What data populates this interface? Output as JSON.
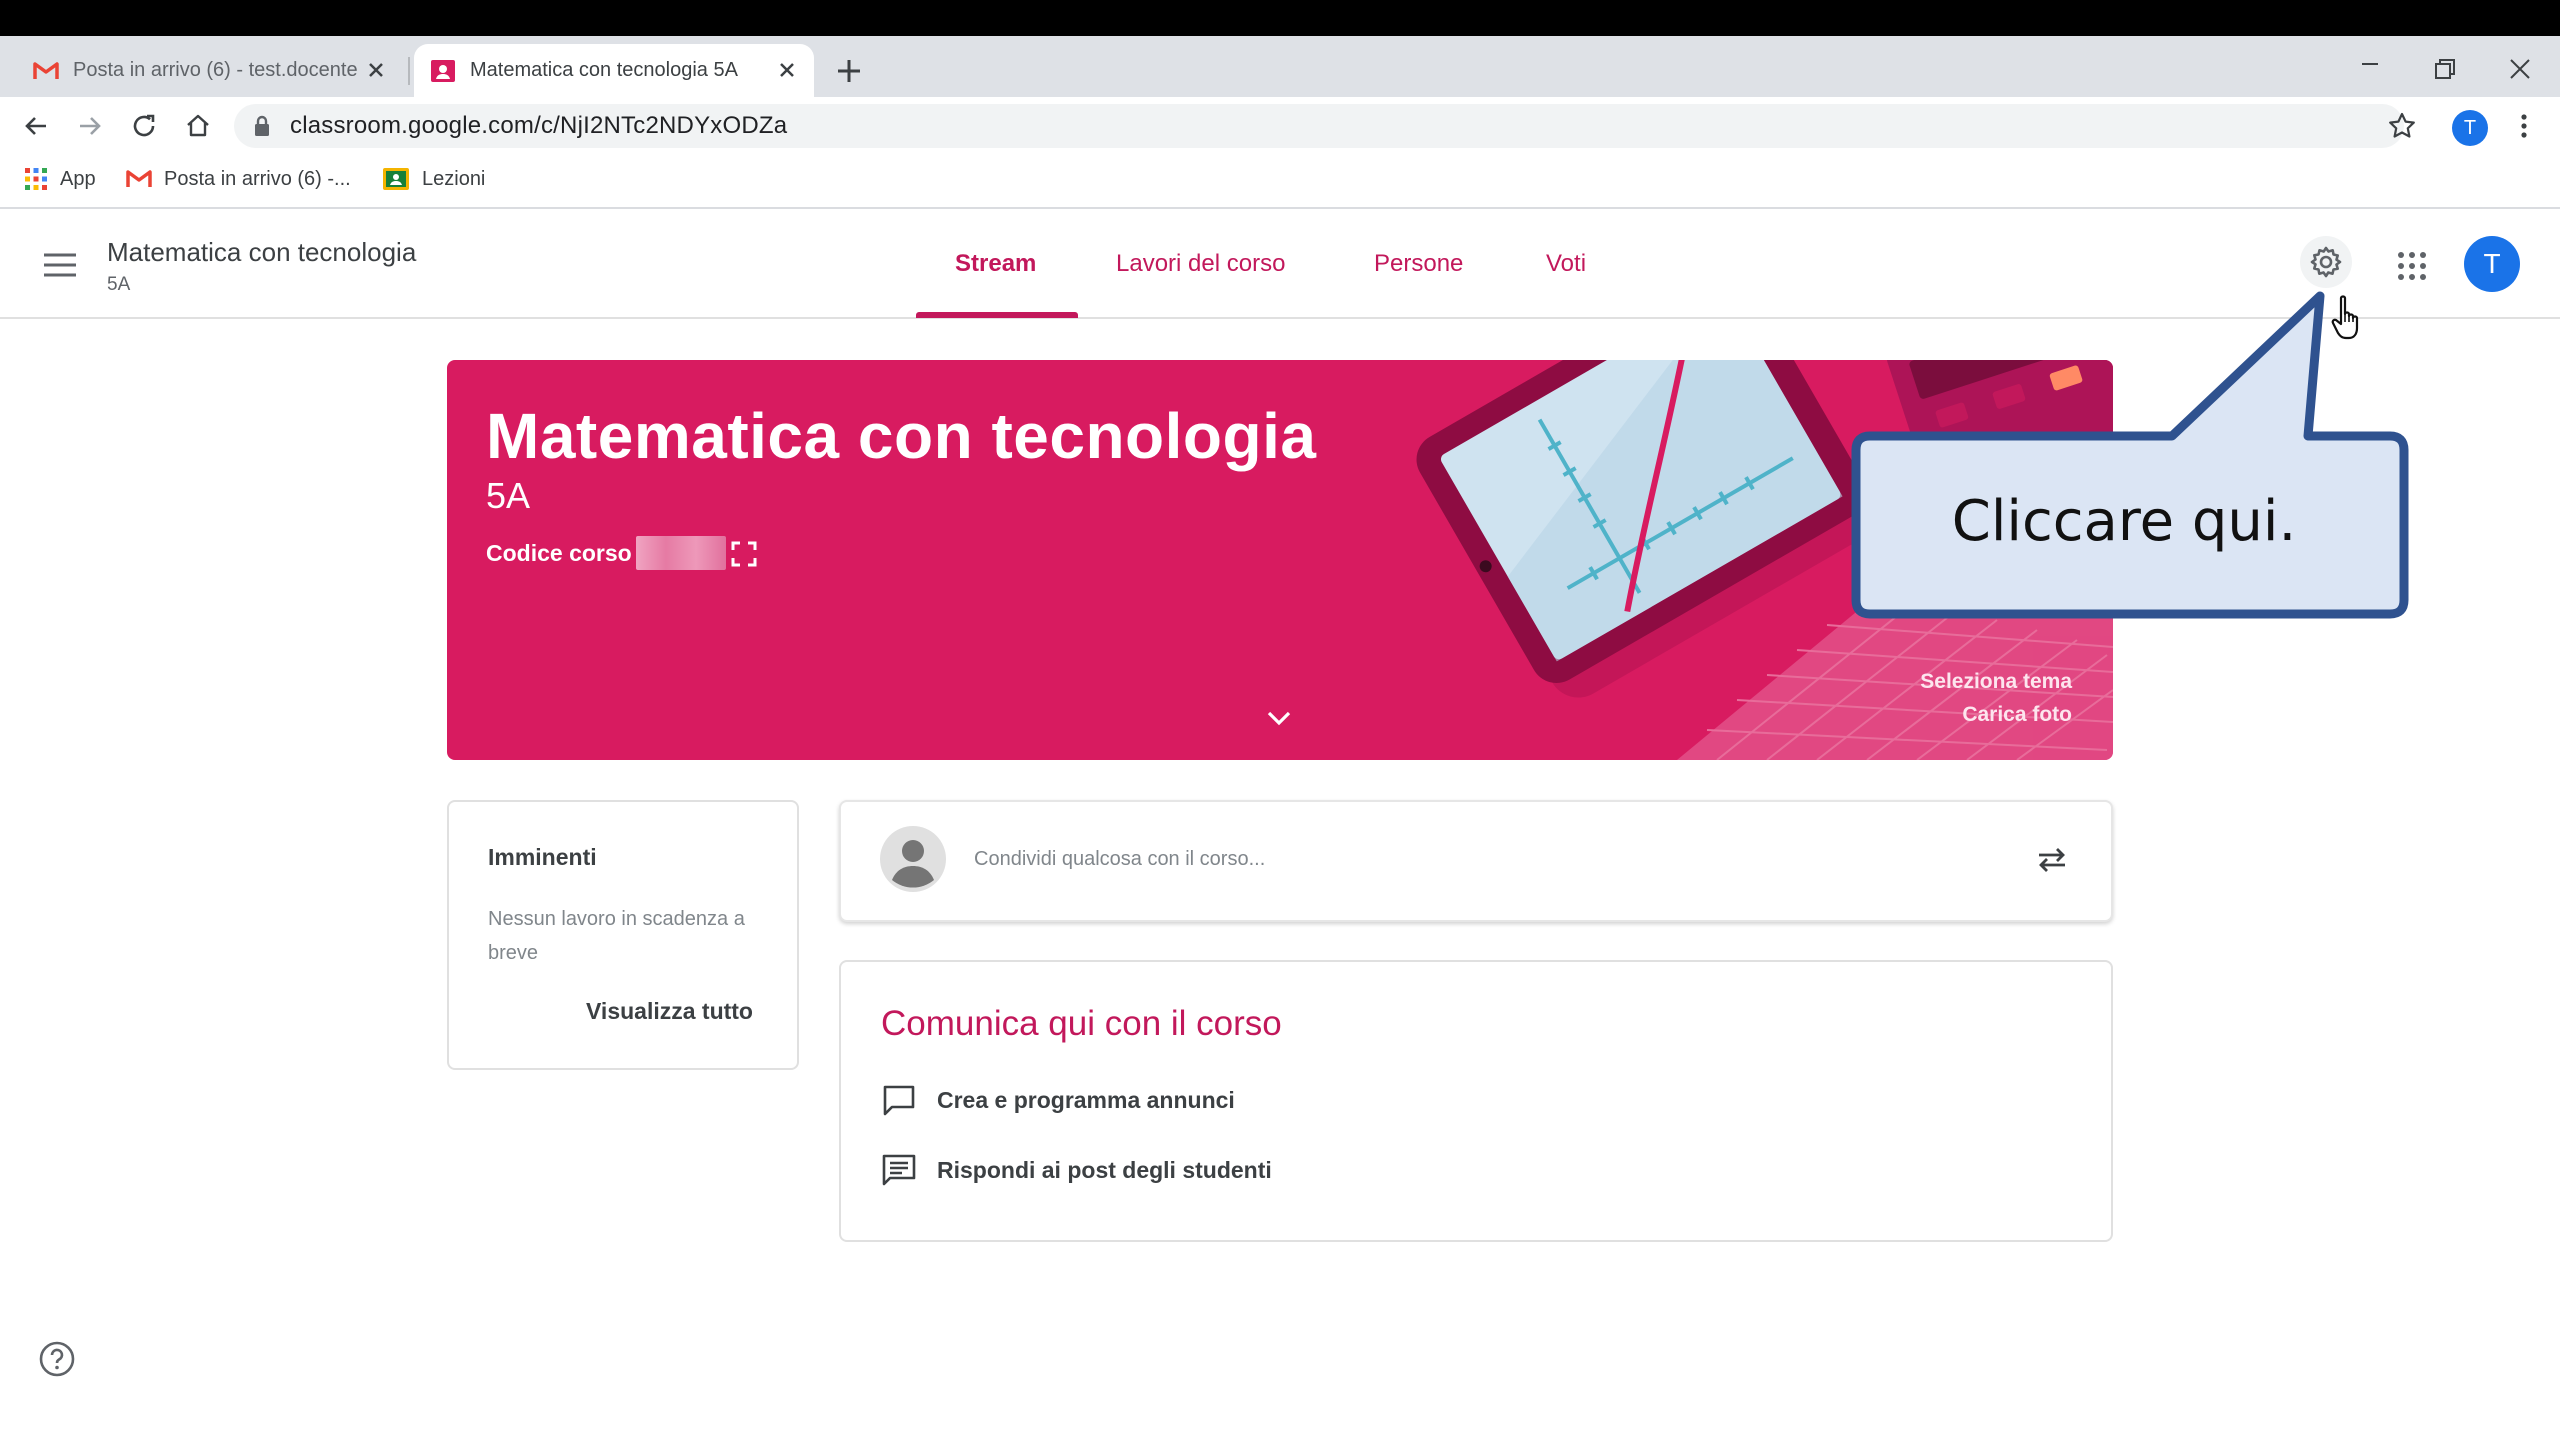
{
  "browser": {
    "tabs": [
      {
        "title": "Posta in arrivo (6) - test.docente"
      },
      {
        "title": "Matematica con tecnologia 5A"
      }
    ],
    "url": "classroom.google.com/c/NjI2NTc2NDYxODZa",
    "profile_initial": "T",
    "bookmarks": [
      {
        "label": "App"
      },
      {
        "label": "Posta in arrivo (6) -..."
      },
      {
        "label": "Lezioni"
      }
    ]
  },
  "header": {
    "course_title": "Matematica con tecnologia",
    "course_section": "5A",
    "tabs": [
      {
        "label": "Stream",
        "active": true
      },
      {
        "label": "Lavori del corso"
      },
      {
        "label": "Persone"
      },
      {
        "label": "Voti"
      }
    ],
    "avatar_initial": "T"
  },
  "banner": {
    "title": "Matematica con tecnologia",
    "section": "5A",
    "code_label": "Codice corso",
    "select_theme": "Seleziona tema",
    "upload_photo": "Carica foto",
    "color": "#d81b60"
  },
  "upcoming": {
    "title": "Imminenti",
    "empty_text": "Nessun lavoro in scadenza a breve",
    "view_all": "Visualizza tutto"
  },
  "share": {
    "placeholder": "Condividi qualcosa con il corso..."
  },
  "communicate": {
    "title": "Comunica qui con il corso",
    "features": [
      {
        "label": "Crea e programma annunci",
        "icon": "announcement-icon"
      },
      {
        "label": "Rispondi ai post degli studenti",
        "icon": "comment-icon"
      }
    ]
  },
  "callout": {
    "text": "Cliccare qui."
  },
  "colors": {
    "accent": "#c2185b",
    "avatar": "#1a73e8",
    "callout_fill": "#dbe5f4",
    "callout_stroke": "#2f528f"
  }
}
